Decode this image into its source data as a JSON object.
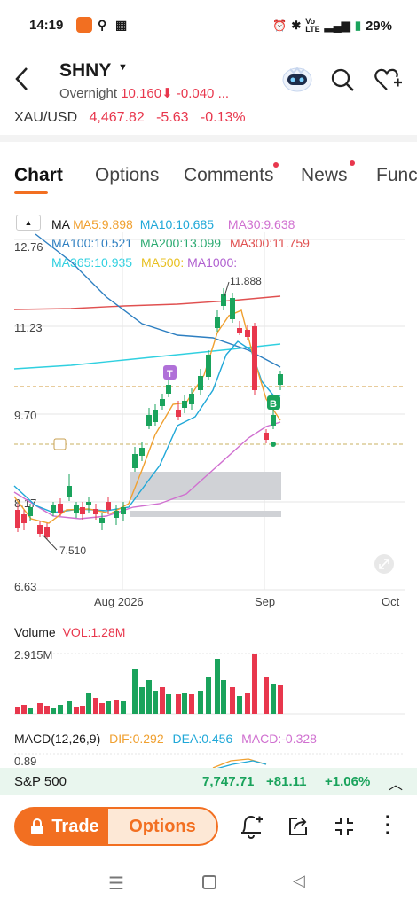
{
  "status_bar": {
    "time": "14:19",
    "battery": "29%"
  },
  "header": {
    "ticker": "SHNY",
    "overnight_label": "Overnight",
    "overnight_price": "10.160",
    "overnight_change": "-0.040",
    "overnight_more": "...",
    "xau_label": "XAU/USD",
    "xau_price": "4,467.82",
    "xau_change": "-5.63",
    "xau_pct": "-0.13%"
  },
  "tabs": [
    {
      "label": "Chart",
      "active": true
    },
    {
      "label": "Options"
    },
    {
      "label": "Comments",
      "dot": true
    },
    {
      "label": "News",
      "dot": true
    },
    {
      "label": "Func"
    }
  ],
  "ma": {
    "label": "MA",
    "ma5": "MA5:9.898",
    "ma10": "MA10:10.685",
    "ma30": "MA30:9.638",
    "ma100": "MA100:10.521",
    "ma200": "MA200:13.099",
    "ma300": "MA300:11.759",
    "ma365": "MA365:10.935",
    "ma500": "MA500:",
    "ma1000": "MA1000:"
  },
  "colors": {
    "up": "#1aa35c",
    "down": "#e8374d",
    "ma5": "#f0a030",
    "ma10": "#20a8d8",
    "ma30": "#d070d0",
    "ma100": "#2d7fc1",
    "ma200": "#2aaa70",
    "ma300": "#e05050",
    "ma365": "#30d0e0",
    "accent": "#f26f21"
  },
  "price_chart": {
    "y_labels": [
      "12.76",
      "11.23",
      "9.70",
      "8.17",
      "6.63"
    ],
    "x_labels": [
      "Aug 2026",
      "Sep",
      "Oct"
    ],
    "high_label": "11.888",
    "low_label": "7.510",
    "marker_t": "T",
    "marker_b": "B"
  },
  "chart_data": {
    "type": "candlestick",
    "ylim": [
      6.63,
      12.76
    ],
    "y_ticks": [
      12.76,
      11.23,
      9.7,
      8.17,
      6.63
    ],
    "x_ticks": [
      "Aug 2026",
      "Sep",
      "Oct"
    ],
    "high": 11.888,
    "low": 7.51
  },
  "volume": {
    "title": "Volume",
    "vol_label": "VOL:1.28M",
    "max_label": "2.915M"
  },
  "macd": {
    "title": "MACD(12,26,9)",
    "dif": "DIF:0.292",
    "dea": "DEA:0.456",
    "macd": "MACD:-0.328",
    "y_label": "0.89"
  },
  "index_ticker": {
    "name": "S&P 500",
    "price": "7,747.71",
    "change": "+81.11",
    "pct": "+1.06%"
  },
  "actions": {
    "trade": "Trade",
    "options": "Options"
  }
}
